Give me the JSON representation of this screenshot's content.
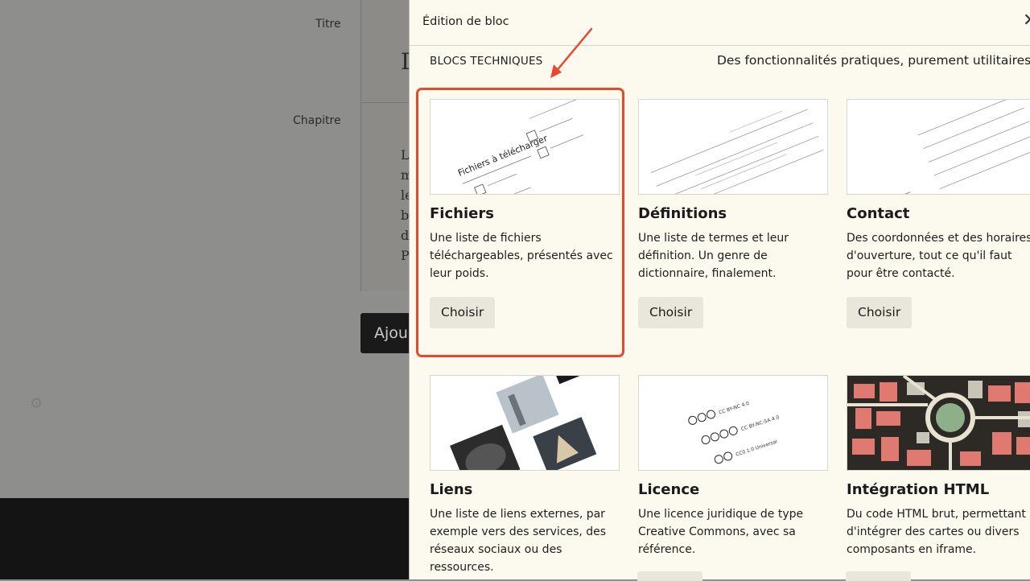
{
  "background": {
    "labels": {
      "title": "Titre",
      "chapter": "Chapitre"
    },
    "title_value": "D",
    "chapter_lines": [
      "L",
      "m",
      "le",
      "b",
      "d",
      "P"
    ],
    "add_button": "Ajou"
  },
  "drawer": {
    "title": "Édition de bloc",
    "close_icon": "close-icon",
    "section": {
      "label": "BLOCS TECHNIQUES",
      "description": "Des fonctionnalités pratiques, purement utilitaires"
    },
    "cards": [
      {
        "title": "Fichiers",
        "description": "Une liste de fichiers téléchargeables, présentés avec leur poids.",
        "button": "Choisir",
        "highlighted": true
      },
      {
        "title": "Définitions",
        "description": "Une liste de termes et leur définition. Un genre de dictionnaire, finalement.",
        "button": "Choisir"
      },
      {
        "title": "Contact",
        "description": "Des coordonnées et des horaires d'ouverture, tout ce qu'il faut pour être contacté.",
        "button": "Choisir"
      },
      {
        "title": "Liens",
        "description": "Une liste de liens externes, par exemple vers des services, des réseaux sociaux ou des ressources.",
        "button": ""
      },
      {
        "title": "Licence",
        "description": "Une licence juridique de type Creative Commons, avec sa référence.",
        "button": ""
      },
      {
        "title": "Intégration HTML",
        "description": "Du code HTML brut, permettant d'intégrer des cartes ou divers composants en iframe.",
        "button": ""
      }
    ],
    "thumbnails": {
      "fichiers": {
        "heading": "Fichiers à télécharger"
      },
      "licence": {
        "lines": [
          "CC BY-NC 4.0",
          "CC BY-NC-SA 4.0",
          "CC0 1.0 Universal"
        ]
      }
    }
  },
  "colors": {
    "accent": "#e8482b",
    "drawer_bg": "#fcfaee",
    "button_bg": "#e9e7dc"
  }
}
